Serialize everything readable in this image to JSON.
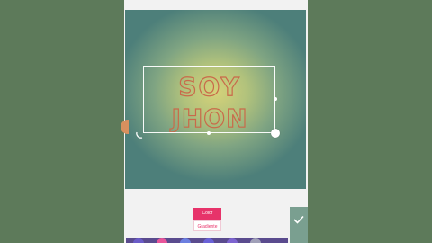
{
  "canvas": {
    "text_lines": [
      "SOY",
      "JHON"
    ],
    "text_stroke_color": "#c96a4a",
    "selection_color": "#ffffff"
  },
  "toolbar": {
    "tabs": [
      {
        "label": "Color",
        "active": true
      },
      {
        "label": "Gradiente",
        "active": false
      }
    ],
    "confirm_icon": "check-icon"
  },
  "palette": {
    "colors": [
      "#6b5cc8",
      "#e8559a",
      "#6c7fe0",
      "#6a62d8",
      "#7d64d0",
      "#a0a0b8"
    ]
  },
  "colors": {
    "accent": "#e7336a",
    "confirm_bg": "#7a9f90"
  }
}
